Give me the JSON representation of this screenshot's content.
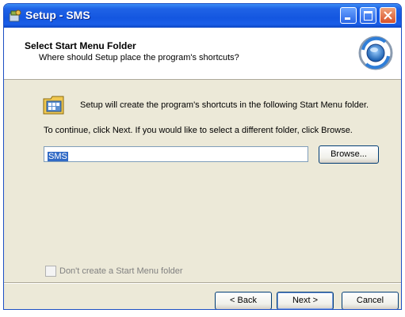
{
  "window": {
    "title": "Setup - SMS"
  },
  "header": {
    "title": "Select Start Menu Folder",
    "subtitle": "Where should Setup place the program's shortcuts?"
  },
  "body": {
    "intro": "Setup will create the program's shortcuts in the following Start Menu folder.",
    "instruction": "To continue, click Next. If you would like to select a different folder, click Browse.",
    "folder_value": "SMS",
    "browse_label": "Browse...",
    "no_folder_checkbox_label": "Don't create a Start Menu folder",
    "no_folder_checked": false
  },
  "footer": {
    "back_label": "< Back",
    "next_label": "Next >",
    "cancel_label": "Cancel"
  },
  "colors": {
    "titlebar": "#1456e0",
    "selection": "#316ac5",
    "dialog": "#ece9d8"
  }
}
